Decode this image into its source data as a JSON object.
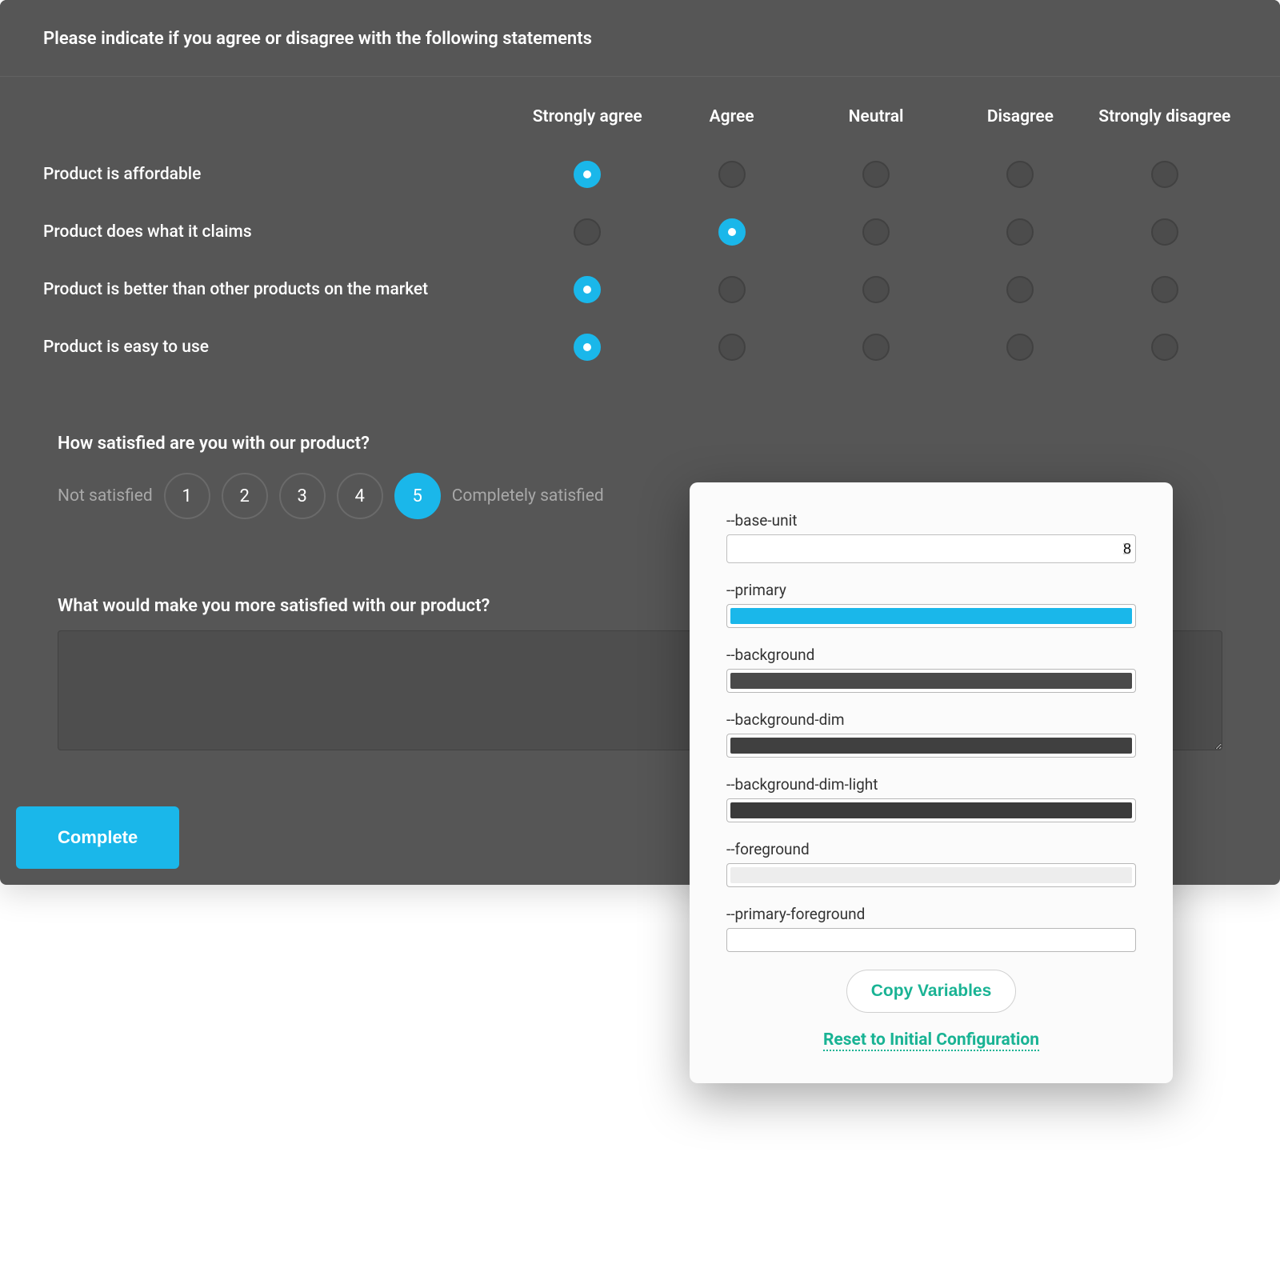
{
  "matrix": {
    "prompt": "Please indicate if you agree or disagree with the following statements",
    "columns": [
      "Strongly agree",
      "Agree",
      "Neutral",
      "Disagree",
      "Strongly disagree"
    ],
    "rows": [
      {
        "label": "Product is affordable",
        "selected": 0
      },
      {
        "label": "Product does what it claims",
        "selected": 1
      },
      {
        "label": "Product is better than other products on the market",
        "selected": 0
      },
      {
        "label": "Product is easy to use",
        "selected": 0
      }
    ]
  },
  "rating": {
    "prompt": "How satisfied are you with our product?",
    "min_label": "Not satisfied",
    "max_label": "Completely satisfied",
    "values": [
      "1",
      "2",
      "3",
      "4",
      "5"
    ],
    "selected": 4
  },
  "comment": {
    "prompt": "What would make you more satisfied with our product?",
    "value": ""
  },
  "complete_label": "Complete",
  "vars_panel": {
    "items": [
      {
        "name": "--base-unit",
        "type": "number",
        "value": "8"
      },
      {
        "name": "--primary",
        "type": "color",
        "value": "#1ab7ea"
      },
      {
        "name": "--background",
        "type": "color",
        "value": "#4a4a4a"
      },
      {
        "name": "--background-dim",
        "type": "color",
        "value": "#404040"
      },
      {
        "name": "--background-dim-light",
        "type": "color",
        "value": "#3a3a3a"
      },
      {
        "name": "--foreground",
        "type": "color",
        "value": "#ededed"
      },
      {
        "name": "--primary-foreground",
        "type": "color",
        "value": "#ffffff"
      }
    ],
    "copy_label": "Copy Variables",
    "reset_label": "Reset to Initial Configuration"
  }
}
